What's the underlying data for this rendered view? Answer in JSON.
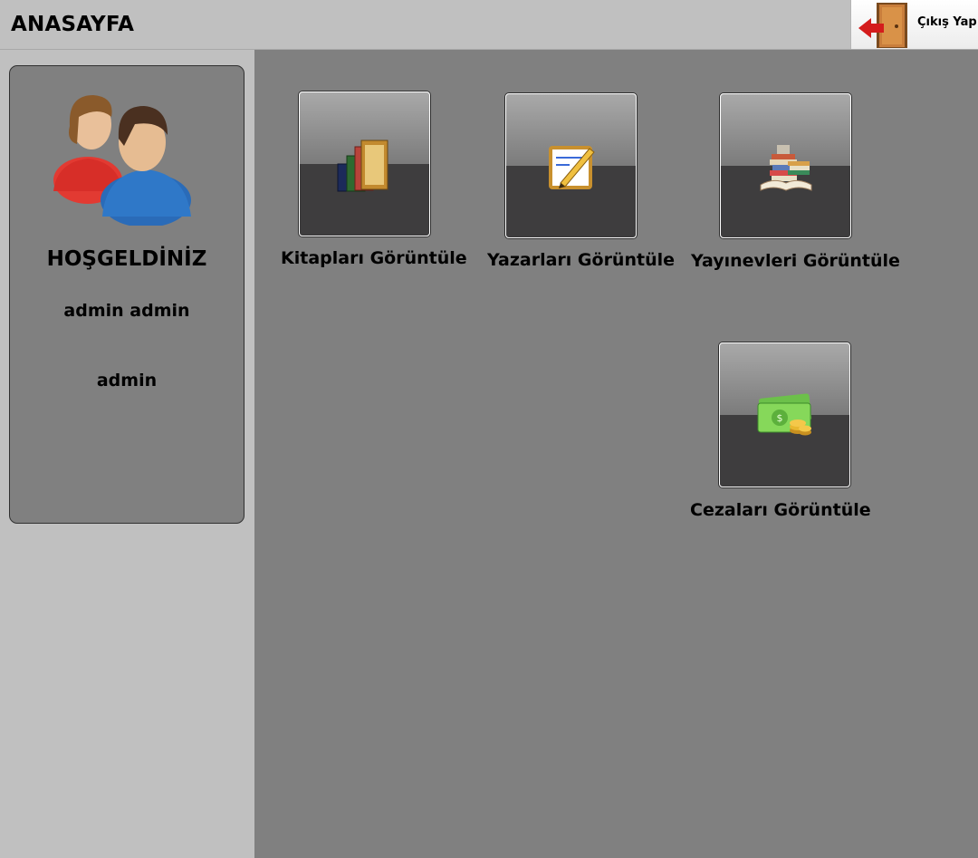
{
  "header": {
    "title": "ANASAYFA",
    "logout_label": "Çıkış Yap"
  },
  "profile": {
    "welcome": "HOŞGELDİNİZ",
    "full_name": "admin admin",
    "role": "admin"
  },
  "tiles": [
    {
      "label": "Kitapları Görüntüle",
      "icon": "books-icon"
    },
    {
      "label": "Yazarları Görüntüle",
      "icon": "notepad-pencil-icon"
    },
    {
      "label": "Yayınevleri Görüntüle",
      "icon": "book-stack-icon"
    },
    {
      "label": "Cezaları Görüntüle",
      "icon": "money-coins-icon"
    }
  ],
  "colors": {
    "panel_gray": "#808080",
    "frame_gray": "#c0c0c0",
    "tile_dark": "#3e3d3e"
  }
}
